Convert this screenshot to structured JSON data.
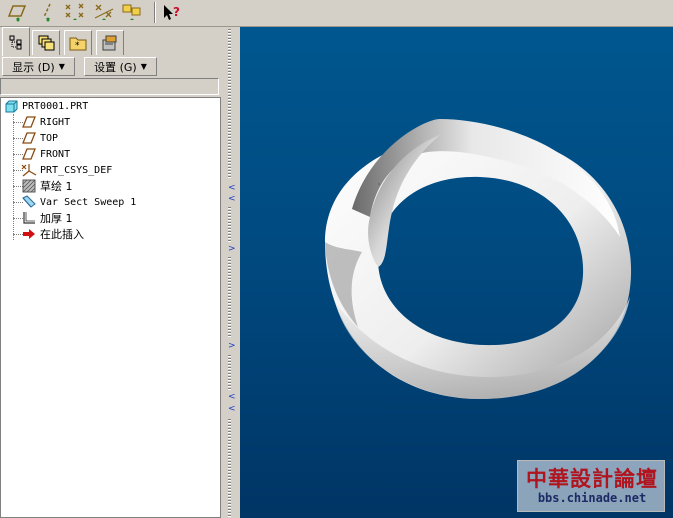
{
  "toolbar": {
    "icons": [
      "datum-plane-icon",
      "datum-axis-icon",
      "datum-point-icon",
      "datum-point-offset-icon",
      "datum-csys-icon",
      "whats-this-help-icon"
    ]
  },
  "tabs": [
    "model-tree-tab",
    "layer-tree-tab",
    "folder-browser-tab",
    "favorites-tab"
  ],
  "menus": {
    "show_label": "显示 (D)",
    "settings_label": "设置 (G)"
  },
  "tree": {
    "root": "PRT0001.PRT",
    "items": [
      {
        "label": "RIGHT",
        "icon": "datum-plane-icon"
      },
      {
        "label": "TOP",
        "icon": "datum-plane-icon"
      },
      {
        "label": "FRONT",
        "icon": "datum-plane-icon"
      },
      {
        "label": "PRT_CSYS_DEF",
        "icon": "csys-icon"
      },
      {
        "label": "草绘 1",
        "icon": "sketch-icon"
      },
      {
        "label": "Var Sect Sweep 1",
        "icon": "sweep-icon"
      },
      {
        "label": "加厚 1",
        "icon": "thicken-icon"
      },
      {
        "label": "在此插入",
        "icon": "insert-here-arrow-icon"
      }
    ]
  },
  "watermark": {
    "title": "中華設計論壇",
    "url": "bbs.chinade.net"
  },
  "colors": {
    "viewport_top": "#00578f",
    "viewport_bottom": "#003565",
    "watermark_red": "#b0141e"
  }
}
